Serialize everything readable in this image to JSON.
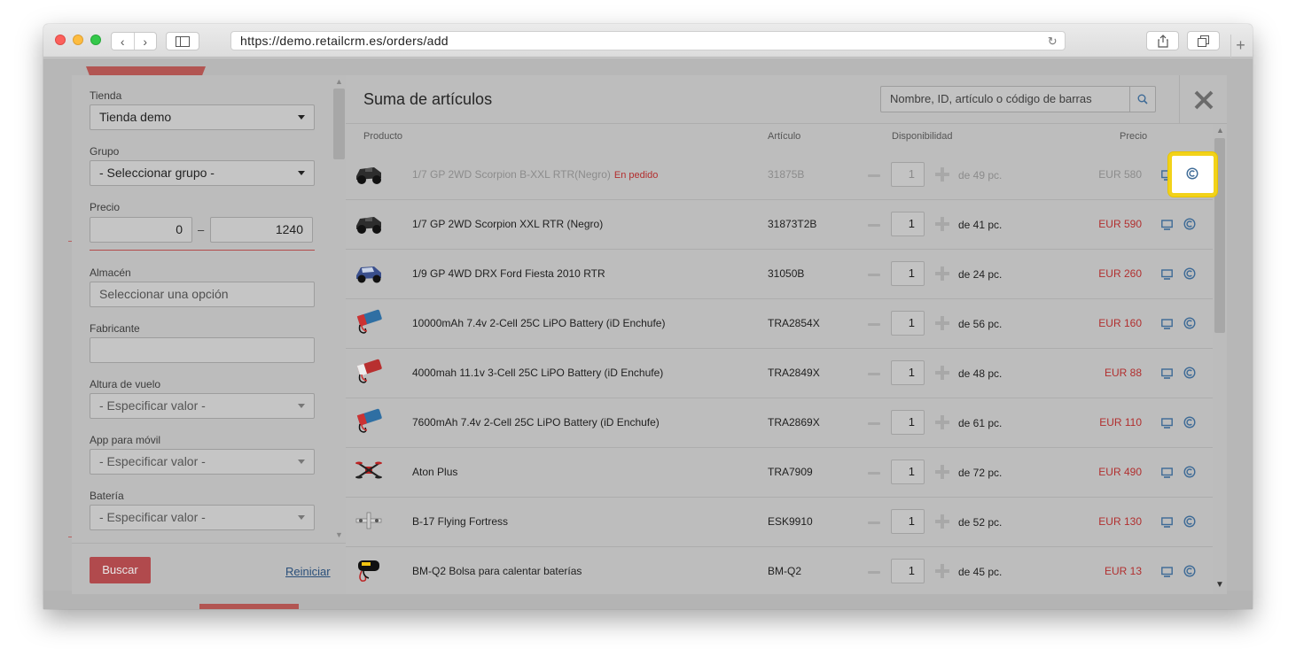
{
  "browser": {
    "url": "https://demo.retailcrm.es/orders/add"
  },
  "filters": {
    "tienda": {
      "label": "Tienda",
      "value": "Tienda demo"
    },
    "grupo": {
      "label": "Grupo",
      "value": "- Seleccionar grupo -"
    },
    "precio": {
      "label": "Precio",
      "min": "0",
      "max": "1240",
      "separator": "–"
    },
    "almacen": {
      "label": "Almacén",
      "placeholder": "Seleccionar una opción"
    },
    "fabricante": {
      "label": "Fabricante",
      "value": ""
    },
    "altura": {
      "label": "Altura de vuelo",
      "value": "- Especificar valor -"
    },
    "app": {
      "label": "App para móvil",
      "value": "- Especificar valor -"
    },
    "bateria": {
      "label": "Batería",
      "value": "- Especificar valor -"
    },
    "search_button": "Buscar",
    "reset_link": "Reiniciar"
  },
  "panel": {
    "title": "Suma de artículos",
    "search_placeholder": "Nombre, ID, artículo o código de barras",
    "columns": {
      "producto": "Producto",
      "articulo": "Artículo",
      "disponibilidad": "Disponibilidad",
      "precio": "Precio"
    },
    "products": [
      {
        "name": "1/7 GP 2WD Scorpion B-XXL RTR(Negro)",
        "tag": "En pedido",
        "sku": "31875B",
        "qty": "1",
        "avail": "de 49 pc.",
        "price": "EUR 580",
        "img": "car-dark"
      },
      {
        "name": "1/7 GP 2WD Scorpion XXL RTR (Negro)",
        "tag": "",
        "sku": "31873T2B",
        "qty": "1",
        "avail": "de 41 pc.",
        "price": "EUR 590",
        "img": "car-dark"
      },
      {
        "name": "1/9 GP 4WD DRX Ford Fiesta 2010 RTR",
        "tag": "",
        "sku": "31050B",
        "qty": "1",
        "avail": "de 24 pc.",
        "price": "EUR 260",
        "img": "car-blue"
      },
      {
        "name": "10000mAh 7.4v 2-Cell 25C LiPO Battery (iD Enchufe)",
        "tag": "",
        "sku": "TRA2854X",
        "qty": "1",
        "avail": "de 56 pc.",
        "price": "EUR 160",
        "img": "battery-blue"
      },
      {
        "name": "4000mah 11.1v 3-Cell 25C LiPO Battery (iD Enchufe)",
        "tag": "",
        "sku": "TRA2849X",
        "qty": "1",
        "avail": "de 48 pc.",
        "price": "EUR 88",
        "img": "battery-red"
      },
      {
        "name": "7600mAh 7.4v 2-Cell 25C LiPO Battery (iD Enchufe)",
        "tag": "",
        "sku": "TRA2869X",
        "qty": "1",
        "avail": "de 61 pc.",
        "price": "EUR 110",
        "img": "battery-blue"
      },
      {
        "name": "Aton Plus",
        "tag": "",
        "sku": "TRA7909",
        "qty": "1",
        "avail": "de 72 pc.",
        "price": "EUR 490",
        "img": "drone-red"
      },
      {
        "name": "B-17 Flying Fortress",
        "tag": "",
        "sku": "ESK9910",
        "qty": "1",
        "avail": "de 52 pc.",
        "price": "EUR 130",
        "img": "plane"
      },
      {
        "name": "BM-Q2 Bolsa para calentar baterías",
        "tag": "",
        "sku": "BM-Q2",
        "qty": "1",
        "avail": "de 45 pc.",
        "price": "EUR 13",
        "img": "bag-black"
      }
    ]
  },
  "colors": {
    "accent_red": "#b12f2f",
    "highlight": "#f2d21a",
    "link": "#2a4f7a"
  }
}
